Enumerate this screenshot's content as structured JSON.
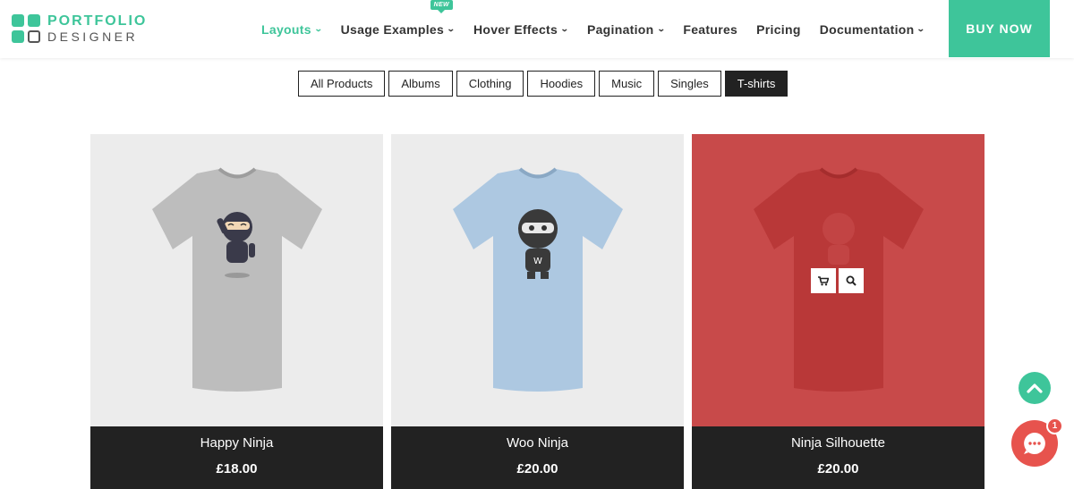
{
  "brand": {
    "line1": "PORTFOLIO",
    "line2": "DESIGNER",
    "accent": "#3ec59a"
  },
  "nav": {
    "items": [
      {
        "label": "Layouts",
        "active": true,
        "dropdown": true
      },
      {
        "label": "Usage Examples",
        "dropdown": true,
        "badge": "NEW"
      },
      {
        "label": "Hover Effects",
        "dropdown": true
      },
      {
        "label": "Pagination",
        "dropdown": true
      },
      {
        "label": "Features",
        "dropdown": false
      },
      {
        "label": "Pricing",
        "dropdown": false
      },
      {
        "label": "Documentation",
        "dropdown": true
      }
    ],
    "buy_label": "BUY NOW"
  },
  "filters": {
    "items": [
      "All Products",
      "Albums",
      "Clothing",
      "Hoodies",
      "Music",
      "Singles",
      "T-shirts"
    ],
    "active": "T-shirts"
  },
  "products": [
    {
      "name": "Happy Ninja",
      "price": "£18.00",
      "shirt_color": "#b9b9b9"
    },
    {
      "name": "Woo Ninja",
      "price": "£20.00",
      "shirt_color": "#a9c6e0"
    },
    {
      "name": "Ninja Silhouette",
      "price": "£20.00",
      "shirt_color": "#b03030",
      "hovered": true
    }
  ],
  "icons": {
    "cart": "cart-icon",
    "search": "search-icon",
    "scroll_top": "chevron-up-icon",
    "chat": "chat-icon"
  },
  "chat": {
    "badge_count": "1"
  }
}
